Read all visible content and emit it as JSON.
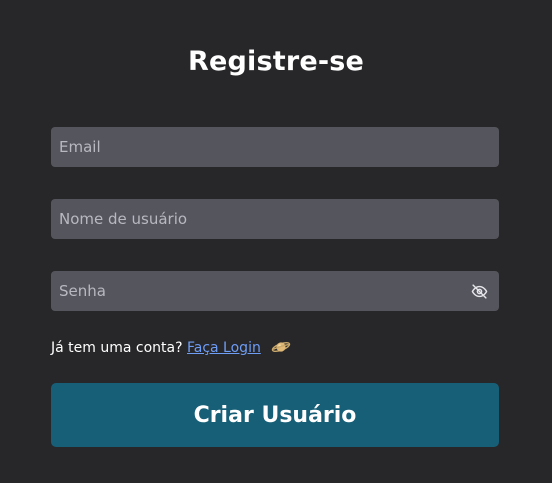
{
  "form": {
    "title": "Registre-se",
    "email": {
      "placeholder": "Email",
      "value": ""
    },
    "username": {
      "placeholder": "Nome de usuário",
      "value": ""
    },
    "password": {
      "placeholder": "Senha",
      "value": "",
      "toggle_icon": "eye-off-icon"
    },
    "login_prompt": "Já tem uma conta?",
    "login_link": "Faça Login",
    "login_icon": "ringed-planet-icon",
    "submit_label": "Criar Usuário"
  },
  "colors": {
    "background": "#272628",
    "input_background": "#55555e",
    "link": "#6e9df5",
    "button": "#175f77"
  }
}
